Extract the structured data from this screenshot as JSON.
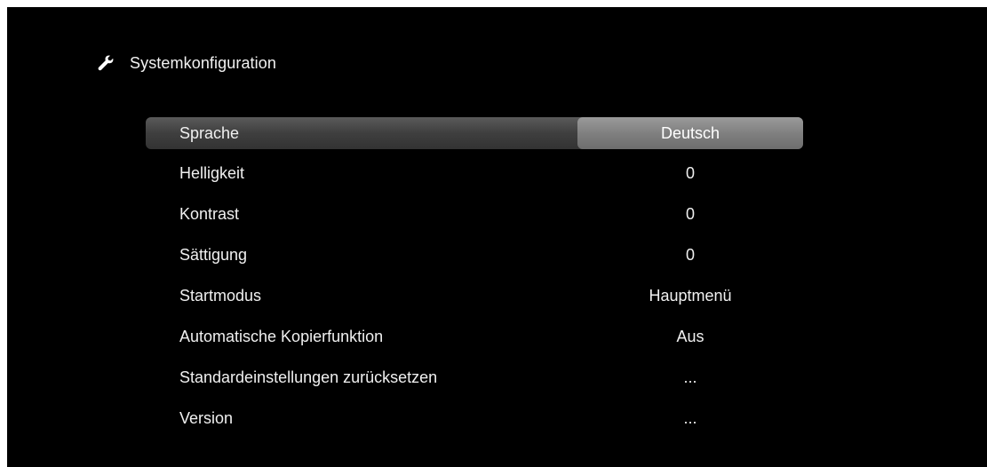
{
  "header": {
    "icon": "wrench-icon",
    "title": "Systemkonfiguration"
  },
  "menu": {
    "items": [
      {
        "label": "Sprache",
        "value": "Deutsch",
        "selected": true
      },
      {
        "label": "Helligkeit",
        "value": "0"
      },
      {
        "label": "Kontrast",
        "value": "0"
      },
      {
        "label": "Sättigung",
        "value": "0"
      },
      {
        "label": "Startmodus",
        "value": "Hauptmenü"
      },
      {
        "label": "Automatische Kopierfunktion",
        "value": "Aus"
      },
      {
        "label": "Standardeinstellungen zurücksetzen",
        "value": "..."
      },
      {
        "label": "Version",
        "value": "..."
      }
    ]
  },
  "colors": {
    "background": "#000000",
    "text": "#f0f0f0",
    "selected_row": "#444444",
    "selected_value": "#888888"
  }
}
